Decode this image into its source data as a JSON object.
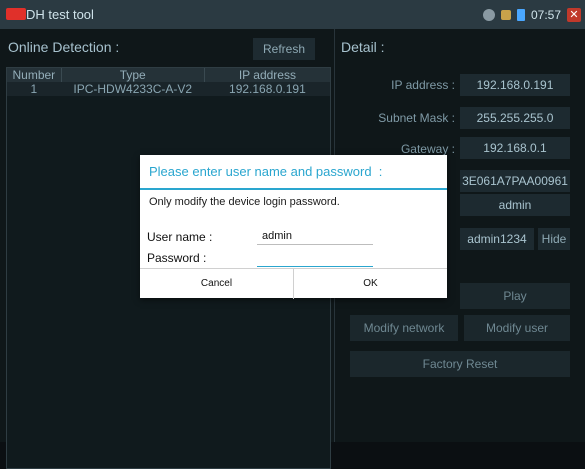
{
  "app": {
    "title": "DH test tool",
    "status": {
      "time": "07:57"
    }
  },
  "left": {
    "heading": "Online Detection :",
    "refresh_label": "Refresh",
    "table": {
      "headers": [
        "Number",
        "Type",
        "IP address"
      ],
      "rows": [
        [
          "1",
          "IPC-HDW4233C-A-V2",
          "192.168.0.191"
        ]
      ]
    }
  },
  "right": {
    "heading": "Detail :",
    "fields": {
      "ip": {
        "label": "IP address :",
        "value": "192.168.0.191"
      },
      "mask": {
        "label": "Subnet Mask :",
        "value": "255.255.255.0"
      },
      "gateway": {
        "label": "Gateway :",
        "value": "192.168.0.1"
      },
      "serial": {
        "value": "3E061A7PAA00961"
      },
      "user": {
        "value": "admin"
      },
      "password": {
        "value": "admin1234"
      }
    },
    "hide_label": "Hide",
    "buttons": {
      "play": "Play",
      "modify_network": "Modify network",
      "modify_user": "Modify user",
      "factory_reset": "Factory Reset"
    }
  },
  "dialog": {
    "title": "Please enter user name and password  :",
    "message": "Only modify the device login password.",
    "username_label": "User name :",
    "username_value": "admin",
    "password_label": "Password :",
    "password_value": "",
    "cancel_label": "Cancel",
    "ok_label": "OK"
  },
  "colors": {
    "accent": "#2aa6cf",
    "background": "#0e1416",
    "titlebar": "#2b3a42"
  }
}
